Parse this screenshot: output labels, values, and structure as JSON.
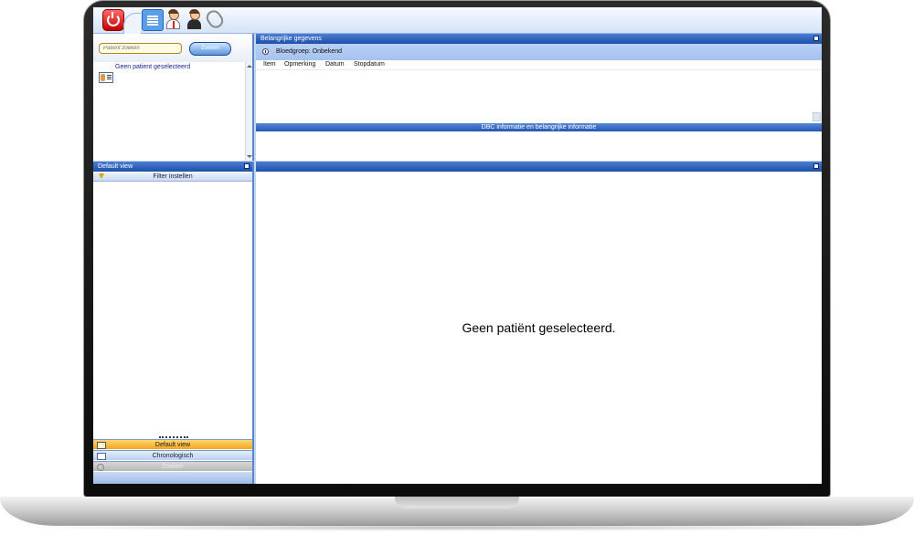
{
  "search": {
    "placeholder": "Patiënt zoeken",
    "button_label": "Zoeken"
  },
  "patient_list": {
    "empty_label": "Geen patient geselecteerd"
  },
  "important_data": {
    "title": "Belangrijke gegevens",
    "blood_group": "Bloedgroep: Onbekend",
    "columns": [
      "Item",
      "Opmerking",
      "Datum",
      "Stopdatum"
    ],
    "dbc_title": "DBC informatie en belangrijke informatie"
  },
  "view_panel": {
    "title": "Default view",
    "filter_label": "Filter instellen",
    "nav_items": [
      "Default view",
      "Chronologisch",
      "Zoeken"
    ]
  },
  "main_panel": {
    "empty_message": "Geen patiënt geselecteerd."
  },
  "ribbon": {
    "icons": [
      "power-icon",
      "list-icon",
      "doctor-icon",
      "nurse-icon",
      "paperclip-icon"
    ]
  },
  "colors": {
    "accent": "#1f4fa8",
    "highlight": "#f5a623",
    "background": "#c5d6ef"
  }
}
